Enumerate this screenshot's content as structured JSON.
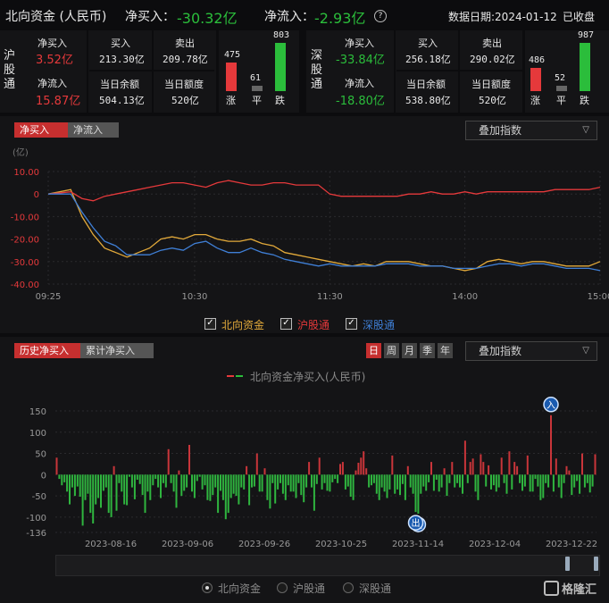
{
  "header": {
    "title": "北向资金 (人民币)",
    "net_buy_label": "净买入：",
    "net_buy_value": "-30.32亿",
    "net_inflow_label": "净流入：",
    "net_inflow_value": "-2.93亿",
    "help_icon": "question-circle-icon",
    "date_label": "数据日期:2024-01-12",
    "status": "已收盘"
  },
  "hu": {
    "name": "沪股通",
    "net_buy_label": "净买入",
    "net_buy_value": "3.52亿",
    "net_inflow_label": "净流入",
    "net_inflow_value": "15.87亿",
    "buy_label": "买入",
    "buy_value": "213.30亿",
    "sell_label": "卖出",
    "sell_value": "209.78亿",
    "balance_label": "当日余额",
    "balance_value": "504.13亿",
    "quota_label": "当日额度",
    "quota_value": "520亿",
    "breadth": {
      "up": 475,
      "flat": 61,
      "down": 803,
      "up_label": "涨",
      "flat_label": "平",
      "down_label": "跌"
    }
  },
  "shen": {
    "name": "深股通",
    "net_buy_label": "净买入",
    "net_buy_value": "-33.84亿",
    "net_inflow_label": "净流入",
    "net_inflow_value": "-18.80亿",
    "buy_label": "买入",
    "buy_value": "256.18亿",
    "sell_label": "卖出",
    "sell_value": "290.02亿",
    "balance_label": "当日余额",
    "balance_value": "538.80亿",
    "quota_label": "当日额度",
    "quota_value": "520亿",
    "breadth": {
      "up": 486,
      "flat": 52,
      "down": 987,
      "up_label": "涨",
      "flat_label": "平",
      "down_label": "跌"
    }
  },
  "intraday": {
    "tabs": [
      "净买入",
      "净流入"
    ],
    "overlay_label": "叠加指数",
    "legend": [
      "北向资金",
      "沪股通",
      "深股通"
    ]
  },
  "history": {
    "tabs": [
      "历史净买入",
      "累计净买入"
    ],
    "periods": [
      "日",
      "周",
      "月",
      "季",
      "年"
    ],
    "overlay_label": "叠加指数",
    "legend_title": "北向资金净买入(人民币)",
    "marker_in": "入",
    "marker_out": "出",
    "bottom_options": [
      "北向资金",
      "沪股通",
      "深股通"
    ]
  },
  "logo_text": "格隆汇",
  "colors": {
    "red": "#e5393b",
    "green": "#2bbd3b",
    "orange": "#e2a93a",
    "blue": "#3f7fd6"
  },
  "chart_data": [
    {
      "type": "line",
      "title": "",
      "ylabel": "(亿)",
      "ylim": [
        -40,
        10
      ],
      "yticks": [
        "10.00",
        "0",
        "-10.00",
        "-20.00",
        "-30.00",
        "-40.00"
      ],
      "x_ticks": [
        "09:25",
        "10:30",
        "11:30",
        "14:00",
        "15:00"
      ],
      "x": [
        "09:25",
        "09:35",
        "09:40",
        "09:45",
        "09:50",
        "09:55",
        "10:00",
        "10:05",
        "10:10",
        "10:15",
        "10:20",
        "10:25",
        "10:30",
        "10:35",
        "10:40",
        "10:45",
        "10:50",
        "10:55",
        "11:00",
        "11:05",
        "11:10",
        "11:15",
        "11:20",
        "11:25",
        "11:30",
        "13:05",
        "13:10",
        "13:15",
        "13:20",
        "13:25",
        "13:30",
        "13:35",
        "13:40",
        "13:45",
        "13:50",
        "13:55",
        "14:00",
        "14:05",
        "14:10",
        "14:15",
        "14:20",
        "14:25",
        "14:30",
        "14:35",
        "14:40",
        "14:45",
        "14:50",
        "14:55",
        "15:00"
      ],
      "series": [
        {
          "name": "北向资金",
          "color": "#e2a93a",
          "values": [
            0,
            2,
            -10,
            -18,
            -24,
            -26,
            -28,
            -26,
            -24,
            -20,
            -19,
            -20,
            -18,
            -18,
            -20,
            -21,
            -21,
            -20,
            -22,
            -23,
            -26,
            -27,
            -28,
            -29,
            -30,
            -31,
            -32,
            -31,
            -32,
            -30,
            -30,
            -30,
            -31,
            -32,
            -32,
            -33,
            -34,
            -33,
            -30,
            -29,
            -30,
            -31,
            -30,
            -30,
            -31,
            -32,
            -32,
            -32,
            -30
          ]
        },
        {
          "name": "沪股通",
          "color": "#e5393b",
          "values": [
            0,
            1,
            -2,
            -3,
            -1,
            0,
            1,
            2,
            3,
            4,
            5,
            5,
            4,
            3,
            5,
            6,
            5,
            4,
            4,
            5,
            5,
            4,
            4,
            4,
            0,
            -1,
            -1,
            -1,
            -1,
            -1,
            -1,
            0,
            0,
            1,
            0,
            0,
            1,
            0,
            1,
            1,
            1,
            1,
            1,
            1,
            2,
            2,
            2,
            2,
            3
          ]
        },
        {
          "name": "深股通",
          "color": "#3f7fd6",
          "values": [
            0,
            0,
            -8,
            -15,
            -21,
            -23,
            -27,
            -27,
            -27,
            -25,
            -24,
            -25,
            -22,
            -21,
            -24,
            -26,
            -26,
            -24,
            -26,
            -27,
            -29,
            -30,
            -31,
            -32,
            -31,
            -32,
            -32,
            -32,
            -32,
            -31,
            -31,
            -31,
            -32,
            -32,
            -32,
            -33,
            -33,
            -33,
            -32,
            -31,
            -31,
            -32,
            -31,
            -31,
            -32,
            -33,
            -33,
            -33,
            -34
          ]
        }
      ]
    },
    {
      "type": "bar",
      "title": "北向资金净买入(人民币)",
      "ylim": [
        -136,
        150
      ],
      "yticks": [
        "150",
        "100",
        "50",
        "0",
        "-50",
        "-100",
        "-136"
      ],
      "x_ticks": [
        "2023-08-16",
        "2023-09-06",
        "2023-09-26",
        "2023-10-25",
        "2023-11-14",
        "2023-12-04",
        "2023-12-22"
      ],
      "values": [
        40,
        -10,
        -25,
        -18,
        -40,
        -70,
        -30,
        -50,
        -28,
        -52,
        -120,
        -60,
        -45,
        -90,
        -115,
        -70,
        -55,
        -78,
        -38,
        -30,
        -90,
        -100,
        20,
        -85,
        -20,
        -40,
        -70,
        -72,
        -5,
        -30,
        -58,
        -12,
        -22,
        -48,
        -90,
        -40,
        -60,
        -25,
        -10,
        -30,
        -55,
        -20,
        -30,
        60,
        -20,
        -40,
        -78,
        10,
        -50,
        -38,
        -30,
        70,
        -40,
        -55,
        -15,
        -5,
        -35,
        -25,
        -60,
        -62,
        -48,
        -30,
        -90,
        -38,
        -60,
        -105,
        -90,
        -55,
        -45,
        -50,
        -70,
        -30,
        -35,
        20,
        -72,
        -30,
        -28,
        50,
        -40,
        -40,
        15,
        -60,
        -80,
        -20,
        -68,
        -35,
        -20,
        -45,
        -60,
        -25,
        -40,
        -40,
        -55,
        -20,
        -48,
        -65,
        -30,
        30,
        -30,
        -85,
        -22,
        40,
        -35,
        -20,
        -38,
        -40,
        -18,
        -10,
        -20,
        25,
        30,
        -35,
        -28,
        -52,
        -60,
        10,
        28,
        40,
        55,
        15,
        -30,
        -25,
        -20,
        -45,
        -60,
        -30,
        -40,
        -55,
        -35,
        45,
        -45,
        -35,
        -48,
        -22,
        -60,
        20,
        -30,
        -45,
        -88,
        -92,
        -45,
        -28,
        -38,
        -18,
        30,
        -38,
        -12,
        -40,
        -30,
        15,
        -50,
        -20,
        30,
        -30,
        -20,
        -30,
        -45,
        80,
        -20,
        30,
        38,
        -40,
        -60,
        48,
        30,
        -28,
        22,
        -35,
        -25,
        -40,
        -30,
        40,
        -20,
        -45,
        55,
        -35,
        30,
        20,
        -20,
        -38,
        -28,
        45,
        -40,
        -40,
        -10,
        -28,
        -60,
        -55,
        -20,
        -30,
        140,
        -40,
        38,
        -30,
        -55,
        -20,
        20,
        10,
        -48,
        -30,
        -15,
        -45,
        50,
        -30,
        -20,
        -42,
        -28,
        48
      ]
    }
  ]
}
